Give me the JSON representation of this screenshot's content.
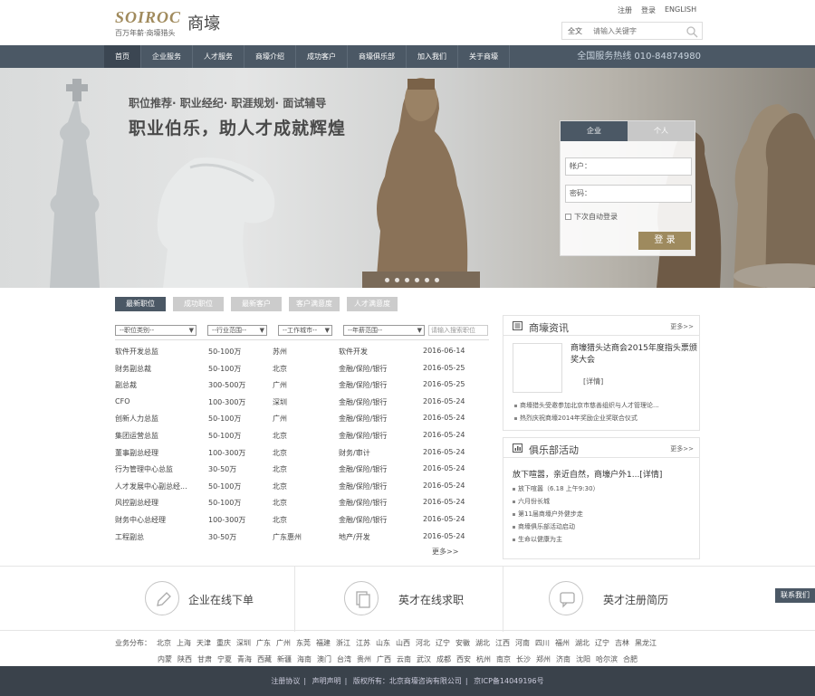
{
  "brand": {
    "en": "SOIROC",
    "cn": "商壕",
    "slogan": "百万年薪·商壕猎头"
  },
  "toplinks": [
    "注册",
    "登录",
    "ENGLISH"
  ],
  "search": {
    "type": "全文",
    "placeholder": "请输入关键字"
  },
  "nav": {
    "items": [
      "首页",
      "企业服务",
      "人才服务",
      "商壕介绍",
      "成功客户",
      "商壕俱乐部",
      "加入我们",
      "关于商壕"
    ],
    "phone": "全国服务热线  010-84874980"
  },
  "banner": {
    "sub": "职位推荐· 职业经纪· 职涯规划· 面试辅导",
    "title": "职业伯乐，助人才成就辉煌"
  },
  "login": {
    "tabs": [
      "企业",
      "个人"
    ],
    "user_label": "帐户：",
    "pass_label": "密码：",
    "remember": "下次自动登录",
    "button": "登 录"
  },
  "jobs": {
    "tabs": [
      "最新职位",
      "成功职位",
      "最新客户",
      "客户满意度",
      "人才满意度"
    ],
    "filters": [
      "--职位类别--",
      "--行业范围--",
      "--工作城市--",
      "--年薪范围--"
    ],
    "keyword_placeholder": "请输入搜索职位",
    "rows": [
      [
        "软件开发总监",
        "50-100万",
        "苏州",
        "软件开发",
        "2016-06-14"
      ],
      [
        "财务副总裁",
        "50-100万",
        "北京",
        "金融/保险/银行",
        "2016-05-25"
      ],
      [
        "副总裁",
        "300-500万",
        "广州",
        "金融/保险/银行",
        "2016-05-25"
      ],
      [
        "CFO",
        "100-300万",
        "深圳",
        "金融/保险/银行",
        "2016-05-24"
      ],
      [
        "创新人力总监",
        "50-100万",
        "广州",
        "金融/保险/银行",
        "2016-05-24"
      ],
      [
        "集团运营总监",
        "50-100万",
        "北京",
        "金融/保险/银行",
        "2016-05-24"
      ],
      [
        "董事副总经理",
        "100-300万",
        "北京",
        "财务/审计",
        "2016-05-24"
      ],
      [
        "行为管理中心总监",
        "30-50万",
        "北京",
        "金融/保险/银行",
        "2016-05-24"
      ],
      [
        "人才发展中心副总经...",
        "50-100万",
        "北京",
        "金融/保险/银行",
        "2016-05-24"
      ],
      [
        "风控副总经理",
        "50-100万",
        "北京",
        "金融/保险/银行",
        "2016-05-24"
      ],
      [
        "财务中心总经理",
        "100-300万",
        "北京",
        "金融/保险/银行",
        "2016-05-24"
      ],
      [
        "工程副总",
        "30-50万",
        "广东惠州",
        "地产/开发",
        "2016-05-24"
      ]
    ],
    "more": "更多>>"
  },
  "news": {
    "title": "商壕资讯",
    "more": "更多>>",
    "headline": "商壕猎头达商会2015年度指头票颁奖大会",
    "detail": "[详情]",
    "items": [
      "商壕猎头受邀参加北京市慈善组织与人才管理论...",
      "热烈庆祝商壕2014年奖励企业奖联合仪式"
    ]
  },
  "club": {
    "title": "俱乐部活动",
    "more": "更多>>",
    "headline": "放下喧嚣，亲近自然，商壕户外1...[详情]",
    "items": [
      "放下喧嚣（6.18 上午9:30）",
      "六月份长城",
      "第11届商壕户外健步走",
      "商壕俱乐部活动启动",
      "生命以健康为主"
    ]
  },
  "services": [
    "企业在线下单",
    "英才在线求职",
    "英才注册简历"
  ],
  "contact": "联系我们",
  "cities": {
    "label": "业务分布：",
    "row1": [
      "北京",
      "上海",
      "天津",
      "重庆",
      "深圳",
      "广东",
      "广州",
      "东莞",
      "福建",
      "浙江",
      "江苏",
      "山东",
      "山西",
      "河北",
      "辽宁",
      "安徽",
      "湖北",
      "江西",
      "河南",
      "四川",
      "福州",
      "湖北",
      "辽宁",
      "吉林",
      "黑龙江"
    ],
    "row2": [
      "内蒙",
      "陕西",
      "甘肃",
      "宁夏",
      "青海",
      "西藏",
      "新疆",
      "海南",
      "澳门",
      "台湾",
      "贵州",
      "广西",
      "云南",
      "武汉",
      "成都",
      "西安",
      "杭州",
      "南京",
      "长沙",
      "郑州",
      "济南",
      "沈阳",
      "哈尔滨",
      "合肥"
    ]
  },
  "footer": [
    "注册协议",
    "声明声明",
    "版权所有：北京商壕咨询有限公司",
    "京ICP备14049196号"
  ],
  "colors": {
    "nav": "#4b5865",
    "accent": "#9e8a5e",
    "footer": "#3a424b"
  }
}
